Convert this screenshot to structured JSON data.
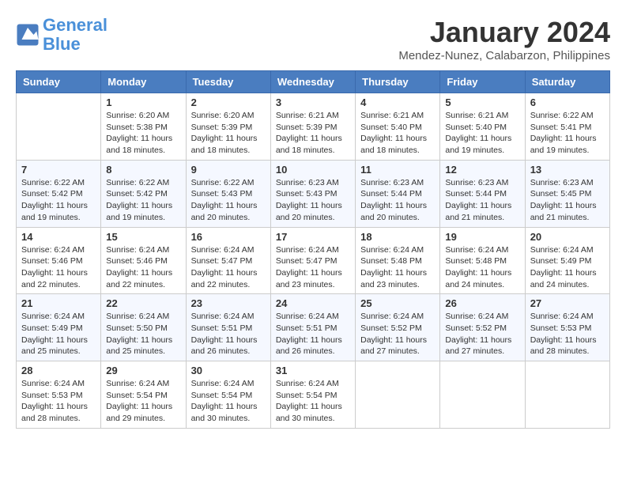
{
  "header": {
    "logo_line1": "General",
    "logo_line2": "Blue",
    "month": "January 2024",
    "location": "Mendez-Nunez, Calabarzon, Philippines"
  },
  "days_of_week": [
    "Sunday",
    "Monday",
    "Tuesday",
    "Wednesday",
    "Thursday",
    "Friday",
    "Saturday"
  ],
  "weeks": [
    [
      {
        "day": "",
        "sunrise": "",
        "sunset": "",
        "daylight": ""
      },
      {
        "day": "1",
        "sunrise": "Sunrise: 6:20 AM",
        "sunset": "Sunset: 5:38 PM",
        "daylight": "Daylight: 11 hours and 18 minutes."
      },
      {
        "day": "2",
        "sunrise": "Sunrise: 6:20 AM",
        "sunset": "Sunset: 5:39 PM",
        "daylight": "Daylight: 11 hours and 18 minutes."
      },
      {
        "day": "3",
        "sunrise": "Sunrise: 6:21 AM",
        "sunset": "Sunset: 5:39 PM",
        "daylight": "Daylight: 11 hours and 18 minutes."
      },
      {
        "day": "4",
        "sunrise": "Sunrise: 6:21 AM",
        "sunset": "Sunset: 5:40 PM",
        "daylight": "Daylight: 11 hours and 18 minutes."
      },
      {
        "day": "5",
        "sunrise": "Sunrise: 6:21 AM",
        "sunset": "Sunset: 5:40 PM",
        "daylight": "Daylight: 11 hours and 19 minutes."
      },
      {
        "day": "6",
        "sunrise": "Sunrise: 6:22 AM",
        "sunset": "Sunset: 5:41 PM",
        "daylight": "Daylight: 11 hours and 19 minutes."
      }
    ],
    [
      {
        "day": "7",
        "sunrise": "Sunrise: 6:22 AM",
        "sunset": "Sunset: 5:42 PM",
        "daylight": "Daylight: 11 hours and 19 minutes."
      },
      {
        "day": "8",
        "sunrise": "Sunrise: 6:22 AM",
        "sunset": "Sunset: 5:42 PM",
        "daylight": "Daylight: 11 hours and 19 minutes."
      },
      {
        "day": "9",
        "sunrise": "Sunrise: 6:22 AM",
        "sunset": "Sunset: 5:43 PM",
        "daylight": "Daylight: 11 hours and 20 minutes."
      },
      {
        "day": "10",
        "sunrise": "Sunrise: 6:23 AM",
        "sunset": "Sunset: 5:43 PM",
        "daylight": "Daylight: 11 hours and 20 minutes."
      },
      {
        "day": "11",
        "sunrise": "Sunrise: 6:23 AM",
        "sunset": "Sunset: 5:44 PM",
        "daylight": "Daylight: 11 hours and 20 minutes."
      },
      {
        "day": "12",
        "sunrise": "Sunrise: 6:23 AM",
        "sunset": "Sunset: 5:44 PM",
        "daylight": "Daylight: 11 hours and 21 minutes."
      },
      {
        "day": "13",
        "sunrise": "Sunrise: 6:23 AM",
        "sunset": "Sunset: 5:45 PM",
        "daylight": "Daylight: 11 hours and 21 minutes."
      }
    ],
    [
      {
        "day": "14",
        "sunrise": "Sunrise: 6:24 AM",
        "sunset": "Sunset: 5:46 PM",
        "daylight": "Daylight: 11 hours and 22 minutes."
      },
      {
        "day": "15",
        "sunrise": "Sunrise: 6:24 AM",
        "sunset": "Sunset: 5:46 PM",
        "daylight": "Daylight: 11 hours and 22 minutes."
      },
      {
        "day": "16",
        "sunrise": "Sunrise: 6:24 AM",
        "sunset": "Sunset: 5:47 PM",
        "daylight": "Daylight: 11 hours and 22 minutes."
      },
      {
        "day": "17",
        "sunrise": "Sunrise: 6:24 AM",
        "sunset": "Sunset: 5:47 PM",
        "daylight": "Daylight: 11 hours and 23 minutes."
      },
      {
        "day": "18",
        "sunrise": "Sunrise: 6:24 AM",
        "sunset": "Sunset: 5:48 PM",
        "daylight": "Daylight: 11 hours and 23 minutes."
      },
      {
        "day": "19",
        "sunrise": "Sunrise: 6:24 AM",
        "sunset": "Sunset: 5:48 PM",
        "daylight": "Daylight: 11 hours and 24 minutes."
      },
      {
        "day": "20",
        "sunrise": "Sunrise: 6:24 AM",
        "sunset": "Sunset: 5:49 PM",
        "daylight": "Daylight: 11 hours and 24 minutes."
      }
    ],
    [
      {
        "day": "21",
        "sunrise": "Sunrise: 6:24 AM",
        "sunset": "Sunset: 5:49 PM",
        "daylight": "Daylight: 11 hours and 25 minutes."
      },
      {
        "day": "22",
        "sunrise": "Sunrise: 6:24 AM",
        "sunset": "Sunset: 5:50 PM",
        "daylight": "Daylight: 11 hours and 25 minutes."
      },
      {
        "day": "23",
        "sunrise": "Sunrise: 6:24 AM",
        "sunset": "Sunset: 5:51 PM",
        "daylight": "Daylight: 11 hours and 26 minutes."
      },
      {
        "day": "24",
        "sunrise": "Sunrise: 6:24 AM",
        "sunset": "Sunset: 5:51 PM",
        "daylight": "Daylight: 11 hours and 26 minutes."
      },
      {
        "day": "25",
        "sunrise": "Sunrise: 6:24 AM",
        "sunset": "Sunset: 5:52 PM",
        "daylight": "Daylight: 11 hours and 27 minutes."
      },
      {
        "day": "26",
        "sunrise": "Sunrise: 6:24 AM",
        "sunset": "Sunset: 5:52 PM",
        "daylight": "Daylight: 11 hours and 27 minutes."
      },
      {
        "day": "27",
        "sunrise": "Sunrise: 6:24 AM",
        "sunset": "Sunset: 5:53 PM",
        "daylight": "Daylight: 11 hours and 28 minutes."
      }
    ],
    [
      {
        "day": "28",
        "sunrise": "Sunrise: 6:24 AM",
        "sunset": "Sunset: 5:53 PM",
        "daylight": "Daylight: 11 hours and 28 minutes."
      },
      {
        "day": "29",
        "sunrise": "Sunrise: 6:24 AM",
        "sunset": "Sunset: 5:54 PM",
        "daylight": "Daylight: 11 hours and 29 minutes."
      },
      {
        "day": "30",
        "sunrise": "Sunrise: 6:24 AM",
        "sunset": "Sunset: 5:54 PM",
        "daylight": "Daylight: 11 hours and 30 minutes."
      },
      {
        "day": "31",
        "sunrise": "Sunrise: 6:24 AM",
        "sunset": "Sunset: 5:54 PM",
        "daylight": "Daylight: 11 hours and 30 minutes."
      },
      {
        "day": "",
        "sunrise": "",
        "sunset": "",
        "daylight": ""
      },
      {
        "day": "",
        "sunrise": "",
        "sunset": "",
        "daylight": ""
      },
      {
        "day": "",
        "sunrise": "",
        "sunset": "",
        "daylight": ""
      }
    ]
  ]
}
